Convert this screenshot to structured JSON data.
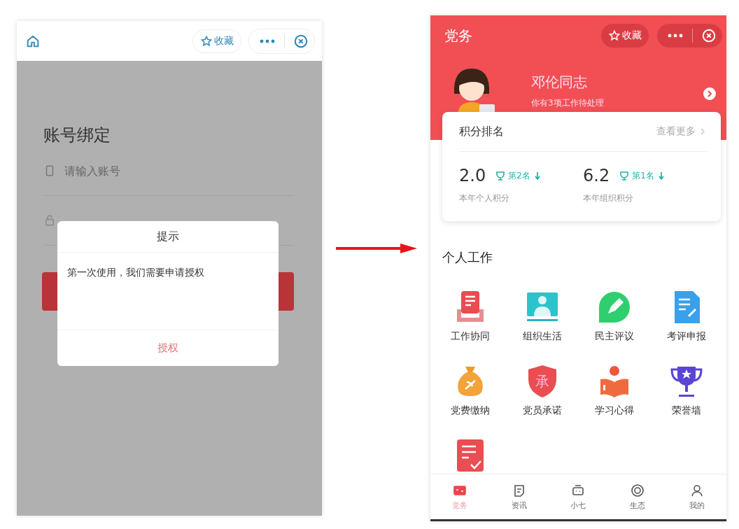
{
  "login_screen": {
    "header": {
      "favorite": "收藏"
    },
    "title": "账号绑定",
    "account_field": {
      "placeholder": "请输入账号"
    },
    "dialog": {
      "title": "提示",
      "message": "第一次使用，我们需要申请授权",
      "button": "授权"
    }
  },
  "home_screen": {
    "header": {
      "title": "党务",
      "favorite": "收藏"
    },
    "profile": {
      "name": "邓伦同志",
      "subtitle": "你有3项工作待处理"
    },
    "ranking": {
      "title": "积分排名",
      "more": "查看更多",
      "stats": [
        {
          "value": "2.0",
          "rank": "第2名",
          "label": "本年个人积分"
        },
        {
          "value": "6.2",
          "rank": "第1名",
          "label": "本年组织积分"
        }
      ]
    },
    "section_title": "个人工作",
    "apps": [
      {
        "kind": "inbox",
        "label": "工作协同"
      },
      {
        "kind": "portrait",
        "label": "组织生活"
      },
      {
        "kind": "pen",
        "label": "民主评议"
      },
      {
        "kind": "report",
        "label": "考评申报"
      },
      {
        "kind": "moneybag",
        "label": "党费缴纳"
      },
      {
        "kind": "shield",
        "label": "党员承诺",
        "badge": "承"
      },
      {
        "kind": "reader",
        "label": "学习心得"
      },
      {
        "kind": "trophy",
        "label": "荣誉墙"
      },
      {
        "kind": "checklist"
      }
    ],
    "tabs": [
      {
        "kind": "card",
        "label": "党务",
        "selected": true
      },
      {
        "kind": "news",
        "label": "资讯",
        "selected": false
      },
      {
        "kind": "robot",
        "label": "小七",
        "selected": false
      },
      {
        "kind": "target",
        "label": "生态",
        "selected": false
      },
      {
        "kind": "person",
        "label": "我的",
        "selected": false
      }
    ]
  }
}
